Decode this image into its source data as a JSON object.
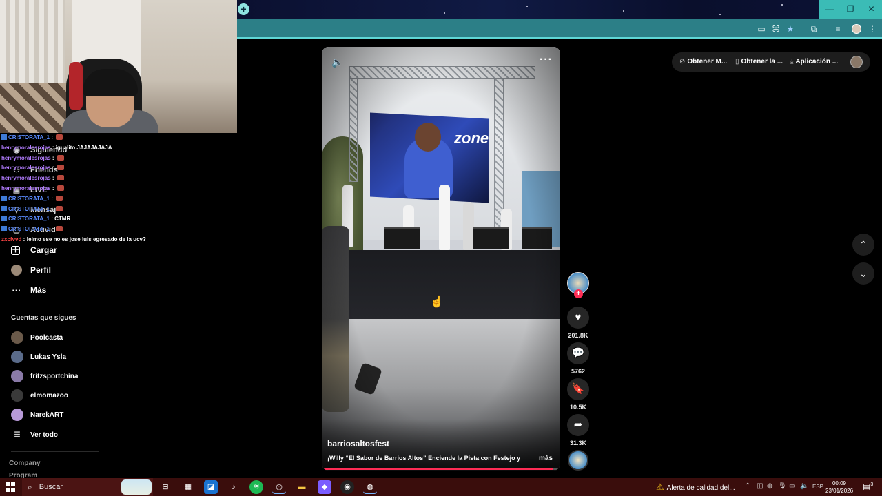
{
  "browser": {
    "window_controls": [
      "—",
      "❐",
      "✕"
    ],
    "toolbar_icons": [
      "cast-icon",
      "translate-icon",
      "bookmark-star-icon",
      "extensions-icon",
      "media-icon",
      "profile-avatar",
      "menu-icon"
    ],
    "accent_color": "#2c7f87"
  },
  "sidebar": {
    "items_behind_chat": [
      {
        "icon": "following-icon",
        "label": "Siguiendo"
      },
      {
        "icon": "friends-icon",
        "label": "Friends"
      },
      {
        "icon": "live-icon",
        "label": "LIVE"
      },
      {
        "icon": "messages-icon",
        "label": "Mensaj"
      },
      {
        "icon": "activity-icon",
        "label": "Activid"
      }
    ],
    "upload": {
      "icon": "＋",
      "label": "Cargar"
    },
    "profile": {
      "label": "Perfil"
    },
    "more": {
      "icon": "···",
      "label": "Más"
    },
    "following_heading": "Cuentas que sigues",
    "following": [
      {
        "name": "Poolcasta",
        "color": "#6b5a4a"
      },
      {
        "name": "Lukas Ysla",
        "color": "#5a6b8a"
      },
      {
        "name": "fritzsportchina",
        "color": "#8a7aa8"
      },
      {
        "name": "elmomazoo",
        "color": "#3a3a3a"
      },
      {
        "name": "NarekART",
        "color": "#b89ad8"
      }
    ],
    "see_all": {
      "icon": "☰",
      "label": "Ver todo"
    },
    "footer": [
      "Company",
      "Program"
    ]
  },
  "chat": [
    {
      "user": "CRISTORATA_1",
      "color": "blue",
      "badge": true,
      "msg": "",
      "emote": true
    },
    {
      "user": "henrymoralesrojas",
      "color": "purple",
      "badge": false,
      "msg": "igualito JAJAJAJAJA",
      "emote": false
    },
    {
      "user": "henrymoralesrojas",
      "color": "purple",
      "badge": false,
      "msg": "",
      "emote": true
    },
    {
      "user": "henrymoralesrojas",
      "color": "purple",
      "badge": false,
      "msg": "",
      "emote": true
    },
    {
      "user": "henrymoralesrojas",
      "color": "purple",
      "badge": false,
      "msg": "",
      "emote": true
    },
    {
      "user": "henrymoralesrojas",
      "color": "purple",
      "badge": false,
      "msg": "",
      "emote": true
    },
    {
      "user": "CRISTORATA_1",
      "color": "blue",
      "badge": true,
      "msg": "",
      "emote": true
    },
    {
      "user": "CRISTORATA_1",
      "color": "blue",
      "badge": true,
      "msg": "",
      "emote": true
    },
    {
      "user": "CRISTORATA_1",
      "color": "blue",
      "badge": true,
      "msg": "CTMR",
      "emote": false
    },
    {
      "user": "CRISTORATA_1",
      "color": "blue",
      "badge": true,
      "msg": "",
      "emote": true
    },
    {
      "user": "zxcfvvd",
      "color": "red",
      "badge": false,
      "msg": "!elmo ese no es jose luis egresado de la ucv?",
      "emote": false
    }
  ],
  "video": {
    "author": "barriosaltosfest",
    "caption": "¡Willy “El Sabor de Barrios Altos” Enciende la Pista con Festejo y",
    "more_label": "más",
    "screen_logo": "zone",
    "progress": 0.98
  },
  "actions": {
    "likes": "201.8K",
    "comments": "5762",
    "saves": "10.5K",
    "shares": "31.3K"
  },
  "top_bar": {
    "pills": [
      {
        "icon": "coin-icon",
        "label": "Obtener M..."
      },
      {
        "icon": "phone-icon",
        "label": "Obtener la ..."
      },
      {
        "icon": "download-icon",
        "label": "Aplicación ..."
      }
    ]
  },
  "taskbar": {
    "search_placeholder": "Buscar",
    "alert": "Alerta de calidad del...",
    "language": "ESP",
    "time": "00:09",
    "date": "23/01/2026",
    "notifications": "3",
    "apps": [
      "task-view-icon",
      "store-icon",
      "outlook-icon",
      "tiktok-icon",
      "spotify-icon",
      "chrome-icon",
      "explorer-icon",
      "figma-icon",
      "obs-icon",
      "chrome-profile-icon"
    ]
  }
}
